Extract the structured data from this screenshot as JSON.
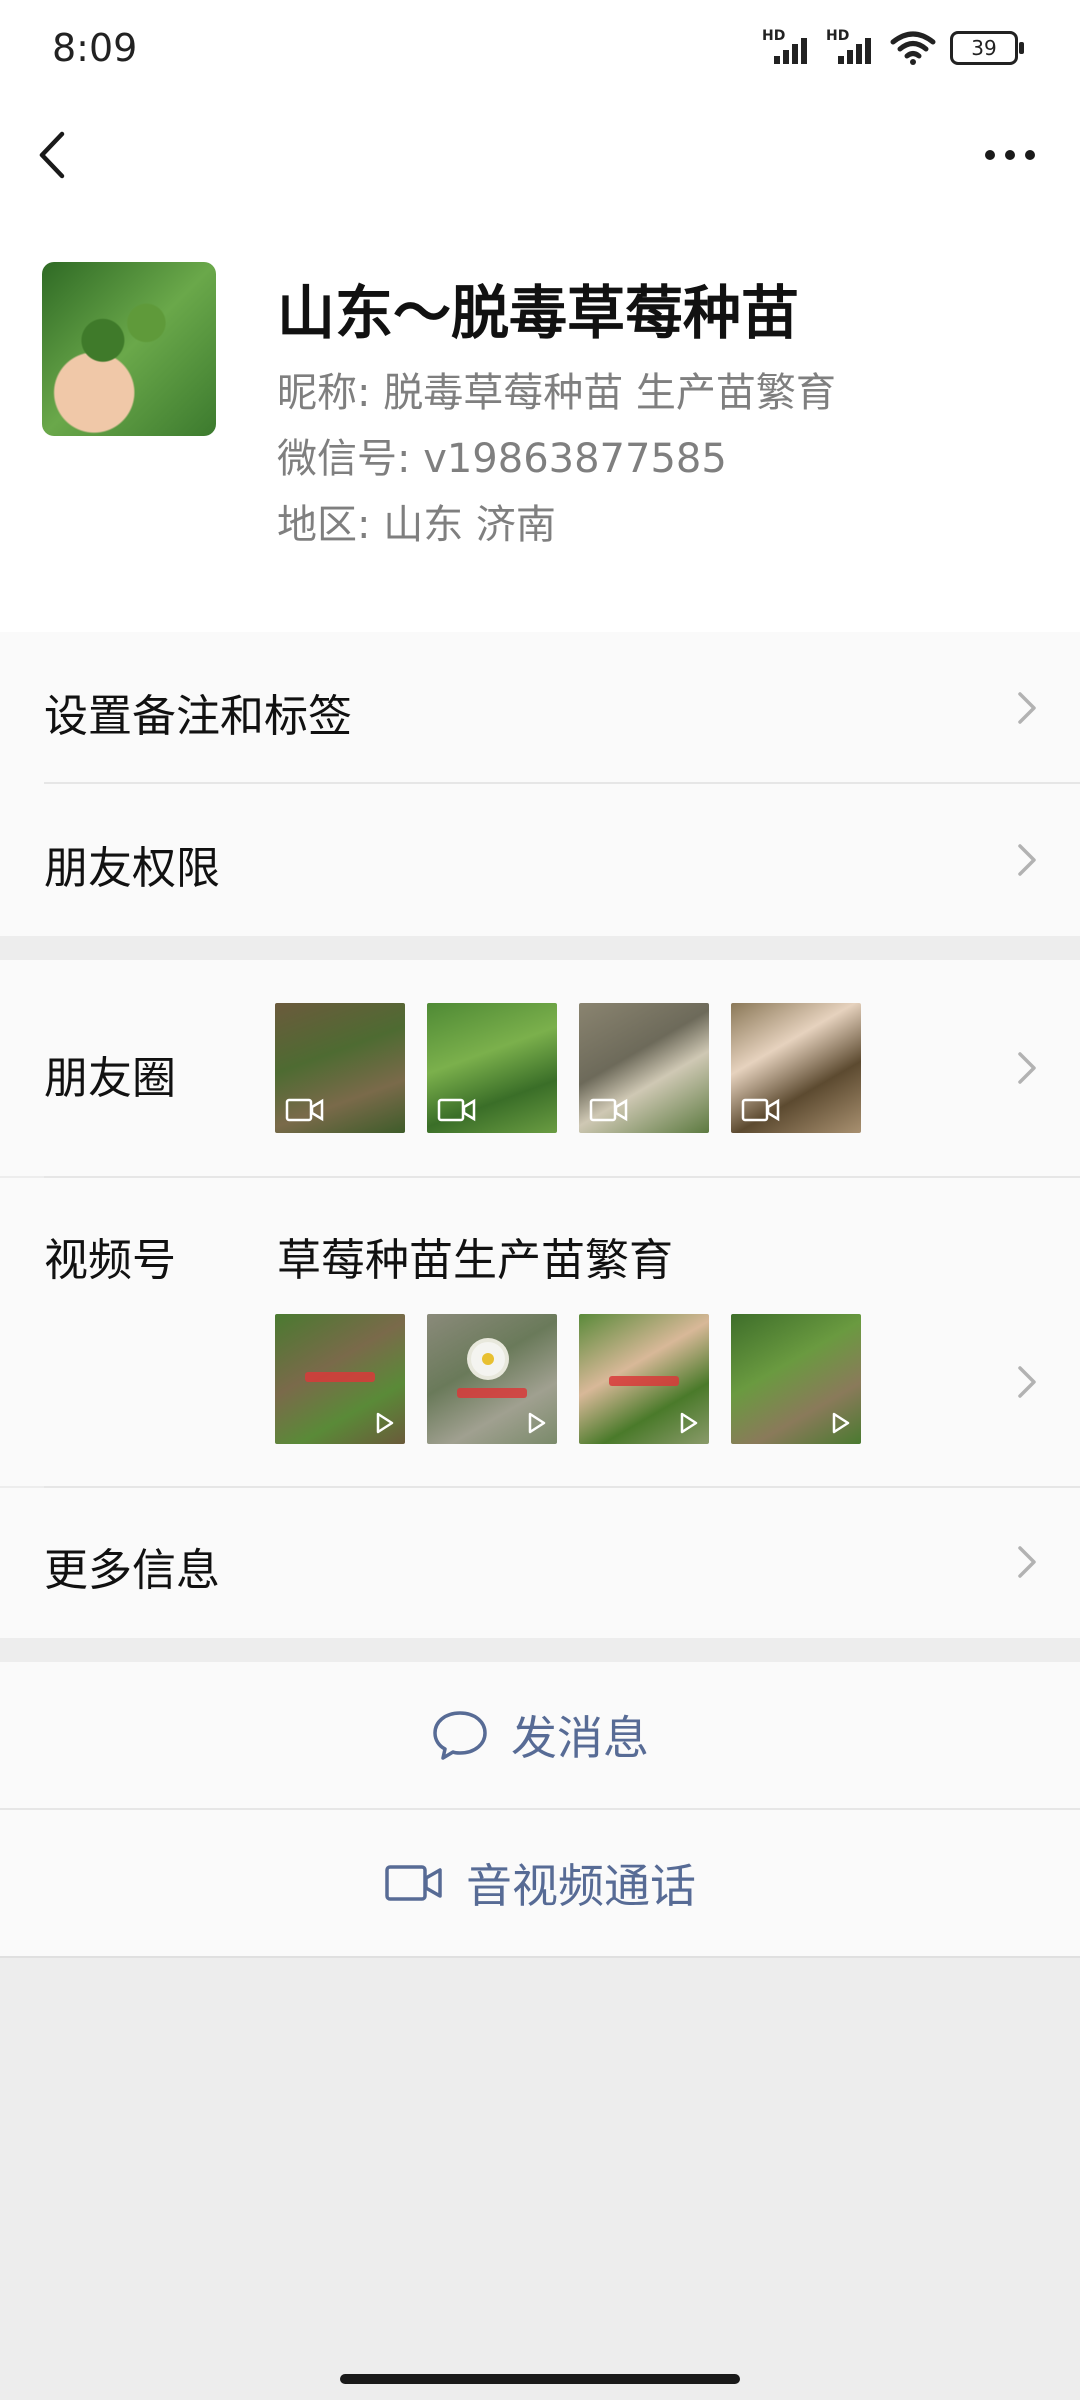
{
  "status_bar": {
    "time": "8:09",
    "signal1_label": "HD",
    "signal2_label": "HD",
    "battery": "39"
  },
  "profile": {
    "name": "山东～脱毒草莓种苗",
    "nickname": "昵称:  脱毒草莓种苗 生产苗繁育",
    "wechat_id": "微信号:  v19863877585",
    "region": "地区:  山东   济南"
  },
  "menu": {
    "set_remark": "设置备注和标签",
    "friend_permissions": "朋友权限",
    "moments": "朋友圈",
    "channels": "视频号",
    "channels_title": "草莓种苗生产苗繁育",
    "more_info": "更多信息"
  },
  "actions": {
    "send_message": "发消息",
    "video_call": "音视频通话"
  },
  "colors": {
    "link_blue": "#576b95",
    "background": "#ededed",
    "card": "#fafafa"
  },
  "icons": {
    "back": "back-arrow-icon",
    "more": "more-dots-icon",
    "chevron": "chevron-right-icon",
    "chat": "chat-bubble-icon",
    "video": "video-camera-icon"
  }
}
